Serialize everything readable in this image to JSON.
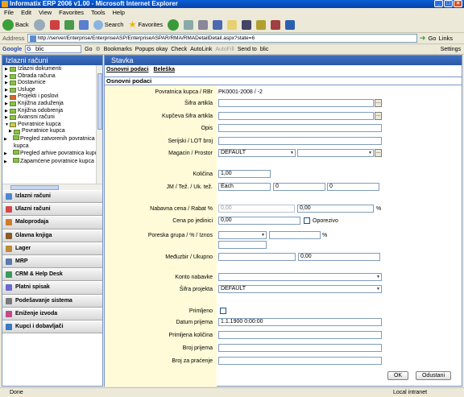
{
  "window": {
    "title": "Informatix ERP 2006 v1.00 - Microsoft Internet Explorer"
  },
  "menu": [
    "File",
    "Edit",
    "View",
    "Favorites",
    "Tools",
    "Help"
  ],
  "toolbar": {
    "back": "Back",
    "search": "Search",
    "favorites": "Favorites"
  },
  "address": {
    "label": "Address",
    "url": "http://server/Enterprise/EnterpriseASP/EnterpriseASPAR/RMA/RMADetailDetail.aspx?state=6",
    "go": "Go",
    "links": "Links"
  },
  "googlebar": {
    "brand": "Google",
    "query": "blic",
    "go": "Go",
    "bookmarks": "Bookmarks",
    "popups": "Popups okay",
    "check": "Check",
    "autolink": "AutoLink",
    "autofill": "AutoFill",
    "sendto": "Send to",
    "blic": "blic",
    "settings": "Settings"
  },
  "sidebar": {
    "title": "Izlazni računi",
    "tree": [
      {
        "label": "Izlazni dokumenti",
        "level": 0
      },
      {
        "label": "Obrada računa",
        "level": 0
      },
      {
        "label": "Dostavnice",
        "level": 0
      },
      {
        "label": "Usluge",
        "level": 0
      },
      {
        "label": "Projekti i poslovi",
        "level": 0
      },
      {
        "label": "Knjižna zaduženja",
        "level": 0
      },
      {
        "label": "Knjižna odobrenja",
        "level": 0
      },
      {
        "label": "Avansni računi",
        "level": 0
      },
      {
        "label": "Povratnice kupca",
        "level": 0
      },
      {
        "label": "Povratnice kupca",
        "level": 1
      },
      {
        "label": "Pregled zatvorenih povratnica kupca",
        "level": 1
      },
      {
        "label": "Pregled arhive povratnica kupca",
        "level": 1
      },
      {
        "label": "Zapamćene povratnice kupca",
        "level": 1
      }
    ],
    "modules": [
      "Izlazni računi",
      "Ulazni računi",
      "Maloprodaja",
      "Glavna knjiga",
      "Lager",
      "MRP",
      "CRM & Help Desk",
      "Platni spisak",
      "Podešavanje sistema",
      "Eniženje izvoda",
      "Kupci i dobavljači"
    ]
  },
  "main": {
    "title": "Stavka",
    "tabs": [
      "Osnovni podaci",
      "Beleška"
    ],
    "section": "Osnovni podaci",
    "labels": {
      "povratnica": "Povratnica kupca / RBr",
      "sifra": "Šifra artikla",
      "kupceva": "Kupčeva šifra artikla",
      "opis": "Opis",
      "serijski": "Serijski / LOT broj",
      "magacin": "Magacin / Prostor",
      "kolicina": "Količina",
      "jm": "JM / Tež. / Uk. tež.",
      "nabavna": "Nabavna cena / Rabat %",
      "cena": "Cena po jedinici",
      "poreska": "Poreska grupa / % / Iznos",
      "meduzbir": "Međuzbir / Ukupno",
      "konto": "Konto nabavke",
      "projekat": "Šifra projekta",
      "primljeno": "Primljeno",
      "datum": "Datum prijema",
      "primljena": "Primljena količina",
      "brojprijema": "Broj prijema",
      "brojpracenje": "Broj za praćenje"
    },
    "values": {
      "povratnica": "PK0001-2008 / -2",
      "magacin": "DEFAULT",
      "kolicina": "1,00",
      "jm": "Each",
      "tez": "0",
      "uktez": "0",
      "nabavna": "0,00",
      "rabat": "0,00",
      "cena": "0,00",
      "oporezivo": "Oporezivo",
      "percent": "%",
      "ukupno": "0,00",
      "projekat": "DEFAULT",
      "datum": "1.1.1900 0:00:00"
    },
    "buttons": {
      "ok": "OK",
      "cancel": "Odustani"
    }
  },
  "status": {
    "left": "Done",
    "right": "Local intranet"
  }
}
